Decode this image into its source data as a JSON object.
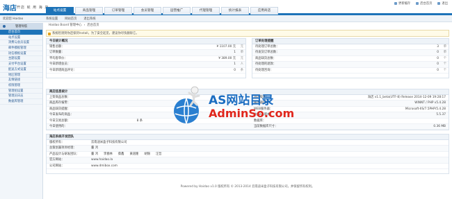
{
  "header": {
    "logo": "海店",
    "slogan": "开店 就 用 海 店",
    "tabs": [
      "站点设置",
      "商品管理",
      "订单管理",
      "会员管理",
      "运营推广",
      "代理管理",
      "统计报表",
      "应用商店"
    ],
    "links": [
      "更新缓存",
      "后台首页",
      "退出"
    ]
  },
  "topbar": {
    "user": "欢迎您 Haidao",
    "subnav": [
      "系统设置",
      "网站首页",
      "退出系统"
    ]
  },
  "sidebar": {
    "title": "管理导航",
    "items": [
      "后台首页",
      "站点设置",
      "消费与会员设置",
      "邮件模板管理",
      "短信模板设置",
      "主题设置",
      "支付平台设置",
      "配送方式设置",
      "地区管理",
      "友情链接",
      "权限管理",
      "管理组设置",
      "管理员日志",
      "数据库管理"
    ]
  },
  "breadcrumb": {
    "items": [
      "Haidao Board 管理中心",
      "后台首页"
    ]
  },
  "notice": "系统检测到你还保持Install，为了安全起见，建议你尽快删除它。",
  "today": {
    "title": "今日统计概况",
    "rows": [
      {
        "label": "销售总额：",
        "value": "¥ 1107.00 元",
        "unit": "元"
      },
      {
        "label": "订单数量：",
        "value": "1",
        "unit": "单"
      },
      {
        "label": "平均客单价：",
        "value": "¥ 389.00 元",
        "unit": "元"
      },
      {
        "label": "今日新增会员：",
        "value": "1",
        "unit": "人"
      },
      {
        "label": "今日新增商品评论：",
        "value": "0",
        "unit": "条"
      }
    ]
  },
  "orders": {
    "title": "订单处理提醒",
    "rows": [
      {
        "label": "待处理订单总数：",
        "value": "3",
        "unit": "单"
      },
      {
        "label": "待发货订单总数：",
        "value": "0",
        "unit": "单"
      },
      {
        "label": "商品缺货总数：",
        "value": "0",
        "unit": "个"
      },
      {
        "label": "待处理的退款：",
        "value": "0",
        "unit": "个"
      },
      {
        "label": "待处理咨询：",
        "value": "0",
        "unit": "个"
      }
    ]
  },
  "sysinfo": {
    "title": "商店信息统计",
    "rows": [
      {
        "label": "上架商品总数：",
        "value": "海店 v1.1_beta(UTF-8) Release 2014-12-09 19:28:17"
      },
      {
        "label": "商品库存报警：",
        "value": "WINNT / PHP v5.4.28"
      },
      {
        "label": "商品缺货提醒：",
        "value": "Microsoft-IIS/7.5PHP/5.4.28"
      },
      {
        "label": "今日发布的商品：",
        "value": "5.5.37"
      },
      {
        "label": "今日交易总额：",
        "value": "8 条"
      },
      {
        "label": "今日使用的：",
        "value": "0.36 MB"
      }
    ],
    "right_labels": [
      "海店版本：",
      "服务器环境：",
      "WEB服务器：",
      "MySQL版本：",
      "数据库：",
      "当前数据库尺寸："
    ]
  },
  "dev": {
    "title": "海店系统开发团队",
    "rows": [
      {
        "label": "版权所有：",
        "value": "云南迪米盒子科技有限公司"
      },
      {
        "label": "总策划兼项目经理：",
        "value": "董 鸿"
      },
      {
        "label": "产品设计与研发团队：",
        "links": [
          "董 鸿",
          "李春林",
          "蔡鑫",
          "黄道隆",
          "胡锦",
          "汪哲"
        ]
      },
      {
        "label": "官方网站：",
        "value": "www.haidao.la"
      },
      {
        "label": "公司网站：",
        "value": "www.dmibox.com"
      }
    ]
  },
  "footer": "Powered by Haidao v1.0 版权所有 © 2013-2014 云南迪米盒子科技有限公司，并保留所有权利。",
  "watermark": {
    "line1": "AS网站目录",
    "line2": "AdminSo.com"
  }
}
